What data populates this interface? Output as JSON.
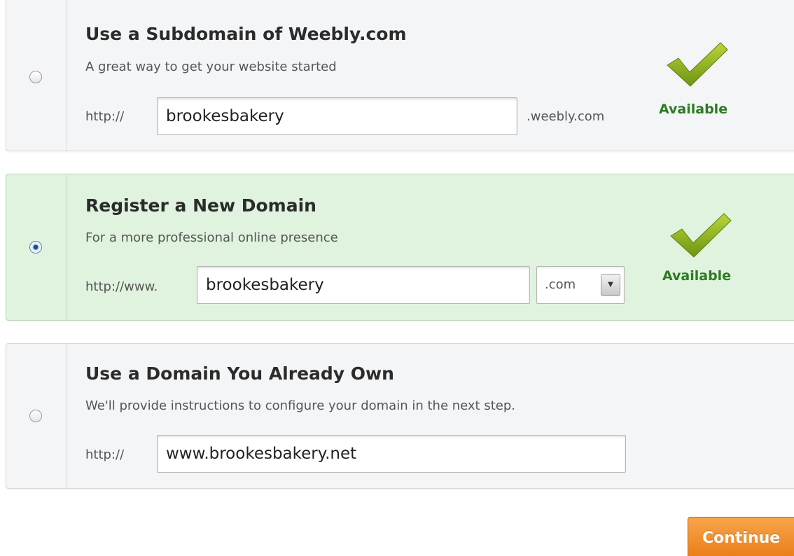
{
  "options": [
    {
      "title": "Use a Subdomain of Weebly.com",
      "subtitle": "A great way to get your website started",
      "prefix": "http://",
      "value": "brookesbakery",
      "suffix": ".weebly.com",
      "status": "Available",
      "selected": false
    },
    {
      "title": "Register a New Domain",
      "subtitle": "For a more professional online presence",
      "prefix": "http://www.",
      "value": "brookesbakery",
      "tld": ".com",
      "status": "Available",
      "selected": true
    },
    {
      "title": "Use a Domain You Already Own",
      "subtitle": "We'll provide instructions to configure your domain in the next step.",
      "prefix": "http://",
      "value": "www.brookesbakery.net",
      "selected": false
    }
  ],
  "continue_label": "Continue",
  "icons": {
    "radio": "radio-button-icon",
    "check": "checkmark-icon",
    "dropdown": "chevron-down-icon"
  },
  "colors": {
    "selected_bg": "#dff3de",
    "available_text": "#2e7a24",
    "check_green": "#8fb31c",
    "continue_bg": "#ea7d17"
  }
}
